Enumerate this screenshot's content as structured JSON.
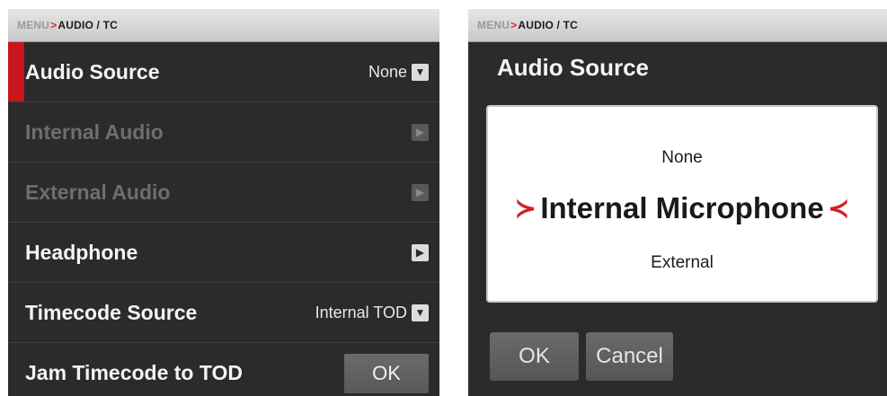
{
  "left": {
    "breadcrumb": {
      "root": "MENU",
      "separator": ">",
      "current": "AUDIO / TC"
    },
    "rows": [
      {
        "label": "Audio Source",
        "value": "None",
        "icon": "chevron-down"
      },
      {
        "label": "Internal Audio",
        "icon": "chevron-right"
      },
      {
        "label": "External Audio",
        "icon": "chevron-right"
      },
      {
        "label": "Headphone",
        "icon": "chevron-right"
      },
      {
        "label": "Timecode Source",
        "value": "Internal TOD",
        "icon": "chevron-down"
      },
      {
        "label": "Jam Timecode to TOD",
        "button": "OK"
      }
    ]
  },
  "right": {
    "breadcrumb": {
      "root": "MENU",
      "separator": ">",
      "current": "AUDIO / TC"
    },
    "title": "Audio Source",
    "options": [
      "None",
      "Internal Microphone",
      "External"
    ],
    "selected_arrows": {
      "left": "≻",
      "right": "≺"
    },
    "buttons": {
      "ok": "OK",
      "cancel": "Cancel"
    }
  },
  "colors": {
    "accent": "#c8161d",
    "background": "#2b2b2b",
    "text": "#f4f4f4",
    "disabled_text": "#6e6e6e"
  }
}
